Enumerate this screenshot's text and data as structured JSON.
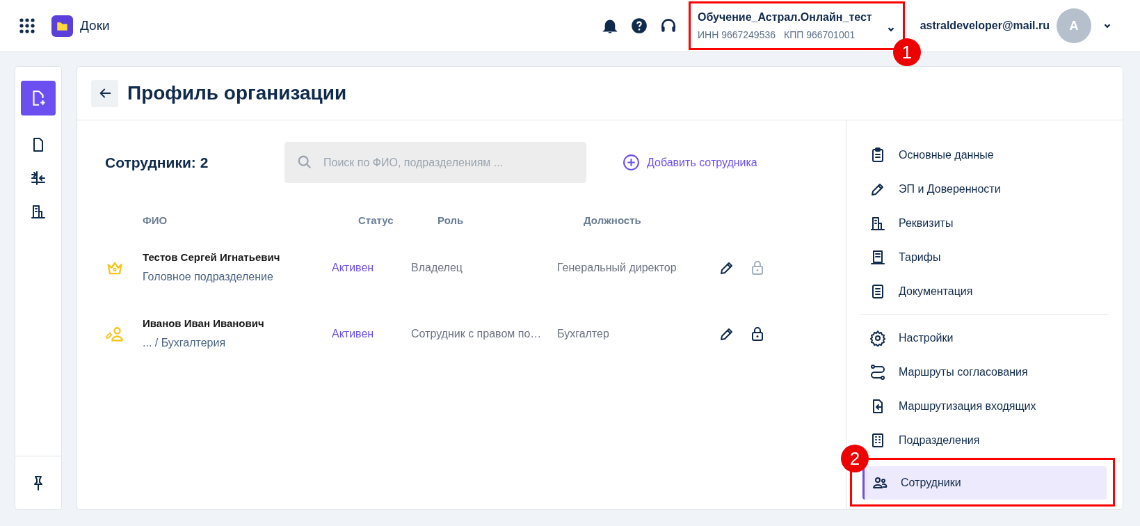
{
  "header": {
    "app_name": "Доки",
    "organization": {
      "name": "Обучение_Астрал.Онлайн_тест",
      "inn": "ИНН 9667249536",
      "kpp": "КПП 966701001",
      "annotation": "1"
    },
    "user_email": "astraldeveloper@mail.ru",
    "avatar_letter": "A"
  },
  "page": {
    "title": "Профиль организации"
  },
  "employees": {
    "count_label": "Сотрудники: 2",
    "search": {
      "placeholder": "Поиск по ФИО, подразделениям ..."
    },
    "add_button": "Добавить сотрудника",
    "columns": [
      "ФИО",
      "Статус",
      "Роль",
      "Должность"
    ],
    "rows": [
      {
        "kind": "owner",
        "name": "Тестов Сергей Игнатьевич",
        "department": "Головное подразделение",
        "status": "Активен",
        "role": "Владелец",
        "position": "Генеральный директор",
        "lock_disabled": true
      },
      {
        "kind": "signer",
        "name": "Иванов Иван Иванович",
        "department": "... / Бухгалтерия",
        "status": "Активен",
        "role": "Сотрудник с правом по…",
        "position": "Бухгалтер",
        "lock_disabled": false
      }
    ]
  },
  "profile_nav": [
    {
      "kind": "clipboard",
      "label": "Основные данные",
      "selected": false
    },
    {
      "kind": "pen",
      "label": "ЭП и Доверенности",
      "selected": false
    },
    {
      "kind": "building",
      "label": "Реквизиты",
      "selected": false
    },
    {
      "kind": "receipt",
      "label": "Тарифы",
      "selected": false
    },
    {
      "kind": "document",
      "label": "Документация",
      "selected": false,
      "divider_after": true
    },
    {
      "kind": "gear",
      "label": "Настройки",
      "selected": false
    },
    {
      "kind": "route",
      "label": "Маршруты согласования",
      "selected": false
    },
    {
      "kind": "incoming",
      "label": "Маршрутизация входящих",
      "selected": false
    },
    {
      "kind": "office",
      "label": "Подразделения",
      "selected": false
    },
    {
      "kind": "people",
      "label": "Сотрудники",
      "selected": true,
      "annotation": "2"
    }
  ]
}
